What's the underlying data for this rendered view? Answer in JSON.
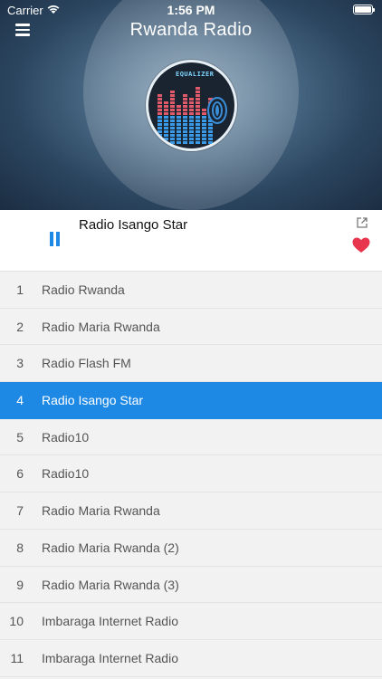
{
  "status_bar": {
    "carrier": "Carrier",
    "time": "1:56 PM"
  },
  "header": {
    "title": "Rwanda Radio",
    "artwork_text": "EQUALIZER"
  },
  "now_playing": {
    "station": "Radio Isango Star",
    "state": "playing"
  },
  "colors": {
    "accent": "#1e88e5",
    "favorite": "#e8344c"
  },
  "stations": [
    {
      "number": "1",
      "name": "Radio Rwanda"
    },
    {
      "number": "2",
      "name": "Radio Maria Rwanda"
    },
    {
      "number": "3",
      "name": "Radio Flash FM"
    },
    {
      "number": "4",
      "name": "Radio Isango Star",
      "selected": true
    },
    {
      "number": "5",
      "name": "Radio10"
    },
    {
      "number": "6",
      "name": "Radio10"
    },
    {
      "number": "7",
      "name": "Radio Maria Rwanda"
    },
    {
      "number": "8",
      "name": "Radio Maria Rwanda (2)"
    },
    {
      "number": "9",
      "name": "Radio Maria Rwanda (3)"
    },
    {
      "number": "10",
      "name": "Imbaraga Internet Radio"
    },
    {
      "number": "11",
      "name": "Imbaraga Internet Radio"
    }
  ]
}
